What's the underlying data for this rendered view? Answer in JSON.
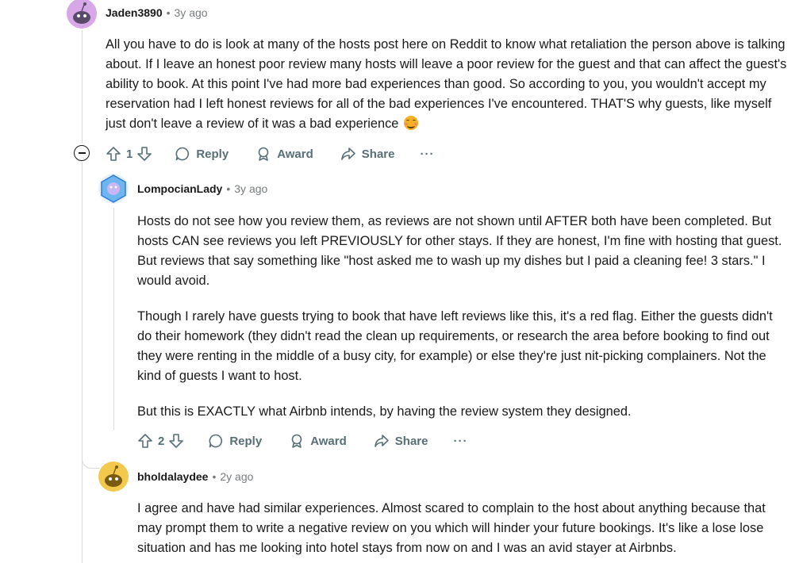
{
  "comments": [
    {
      "author": "Jaden3890",
      "separator": "•",
      "time": "3y ago",
      "avatar_color": "#d7a7e8",
      "paragraphs": [
        "All you have to do is look at many of the hosts post here on Reddit to know what retaliation the person above is talking about. If I leave an honest poor review many hosts will leave a poor review for the guest and that can affect the guest's ability to book. At this point I've had more bad experiences than good. So according to you, you wouldn't accept my reservation had I left honest reviews for all of the bad experiences I've encountered. THAT'S why guests, like myself just don't leave a review of it was a bad experience"
      ],
      "emoji": "smiling-face-with-smiling-eyes",
      "votes": "1",
      "reply_label": "Reply",
      "award_label": "Award",
      "share_label": "Share",
      "more_label": "···"
    },
    {
      "author": "LompocianLady",
      "separator": "•",
      "time": "3y ago",
      "avatar_color": "#5aa7e8",
      "paragraphs": [
        "Hosts do not see how you review them, as reviews are not shown until AFTER both have been completed. But hosts CAN see reviews you left PREVIOUSLY for other stays. If they are honest, I'm fine with hosting that guest. But reviews that say something like \"host asked me to wash up my dishes but I paid a cleaning fee! 3 stars.\" I would avoid.",
        "Though I rarely have guests trying to book that have left reviews like this, it's a red flag. Either the guests didn't do their homework (they didn't read the clean up requirements, or research the area before booking to find out they were renting in the middle of a busy city, for example) or else they're just nit-picking complainers. Not the kind of guests I want to host.",
        "But this is EXACTLY what Airbnb intends, by having the review system they designed."
      ],
      "votes": "2",
      "reply_label": "Reply",
      "award_label": "Award",
      "share_label": "Share",
      "more_label": "···"
    },
    {
      "author": "bholdalaydee",
      "separator": "•",
      "time": "2y ago",
      "avatar_color": "#f2c94c",
      "paragraphs": [
        "I agree and have had similar experiences. Almost scared to complain to the host about anything because that may prompt them to write a negative review on you which will hinder your future bookings. It's like a lose lose situation and has me looking into hotel stays from now on and I was an avid stayer at Airbnbs."
      ]
    }
  ]
}
